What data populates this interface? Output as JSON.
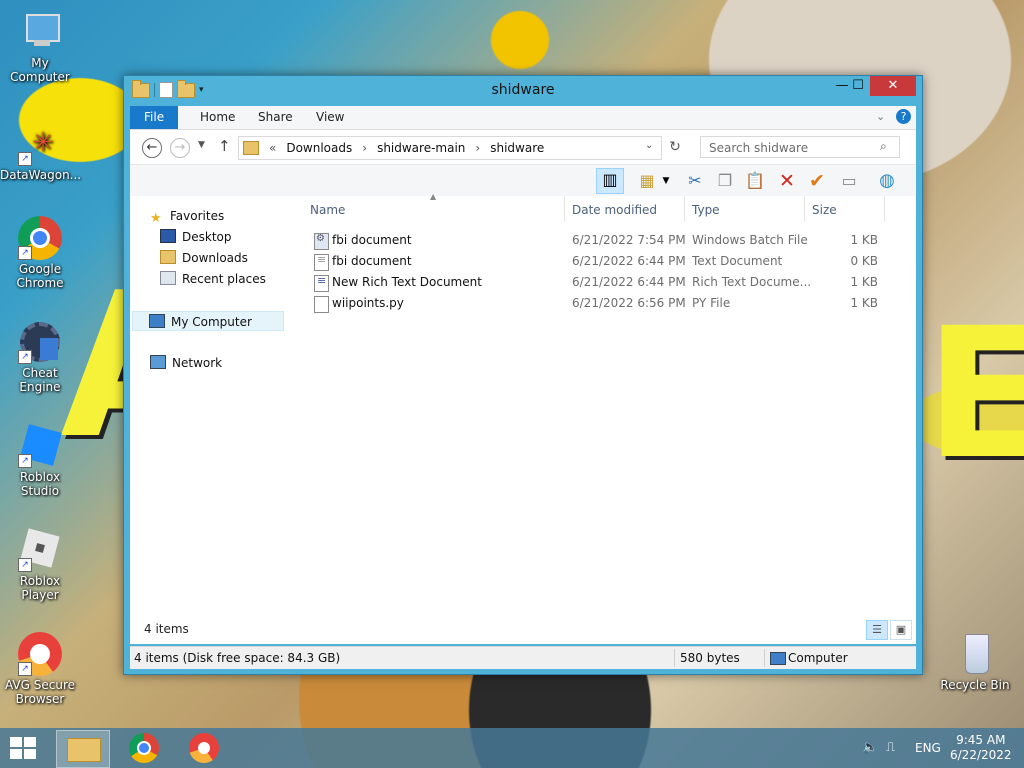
{
  "desktop": {
    "icons": [
      {
        "label": "My Computer"
      },
      {
        "label": "DataWagon..."
      },
      {
        "label": "Google Chrome"
      },
      {
        "label": "Cheat Engine"
      },
      {
        "label": "Roblox Studio"
      },
      {
        "label": "Roblox Player"
      },
      {
        "label": "AVG Secure Browser"
      },
      {
        "label": "Recycle Bin"
      }
    ]
  },
  "window": {
    "title": "shidware",
    "buttons": {
      "minimize": "—",
      "maximize": "☐",
      "close": "✕"
    },
    "ribbon_tabs": [
      "File",
      "Home",
      "Share",
      "View"
    ],
    "nav": {
      "back_icon": "←",
      "forward_icon": "→",
      "up_icon": "↑",
      "breadcrumb": [
        "«",
        "Downloads",
        "›",
        "shidware-main",
        "›",
        "shidware"
      ],
      "search_placeholder": "Search shidware"
    },
    "navpane": {
      "favorites": "Favorites",
      "desktop": "Desktop",
      "downloads": "Downloads",
      "recent": "Recent places",
      "computer": "My Computer",
      "network": "Network"
    },
    "columns": {
      "name": "Name",
      "date": "Date modified",
      "type": "Type",
      "size": "Size"
    },
    "files": [
      {
        "name": "fbi document",
        "date": "6/21/2022 7:54 PM",
        "type": "Windows Batch File",
        "size": "1 KB",
        "icon": "batch-file-icon"
      },
      {
        "name": "fbi document",
        "date": "6/21/2022 6:44 PM",
        "type": "Text Document",
        "size": "0 KB",
        "icon": "text-file-icon"
      },
      {
        "name": "New Rich Text Document",
        "date": "6/21/2022 6:44 PM",
        "type": "Rich Text Docume...",
        "size": "1 KB",
        "icon": "rtf-file-icon"
      },
      {
        "name": "wiipoints.py",
        "date": "6/21/2022 6:56 PM",
        "type": "PY File",
        "size": "1 KB",
        "icon": "py-file-icon"
      }
    ],
    "item_count": "4 items",
    "status": {
      "left": "4 items (Disk free space: 84.3 GB)",
      "size": "580 bytes",
      "location": "Computer"
    }
  },
  "taskbar": {
    "lang": "ENG",
    "time": "9:45 AM",
    "date": "6/22/2022"
  }
}
